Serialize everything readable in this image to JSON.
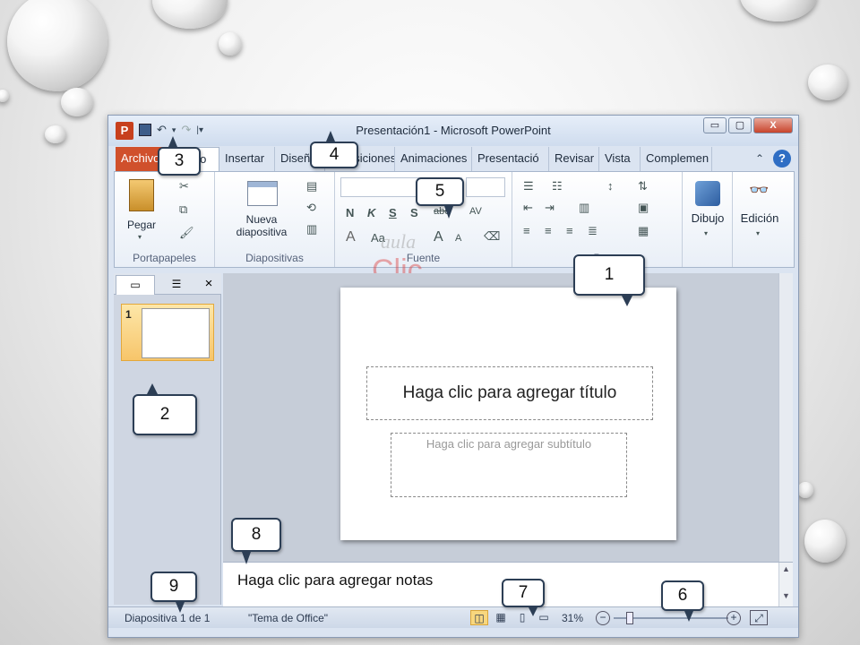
{
  "window": {
    "title": "Presentación1  -  Microsoft PowerPoint",
    "app_icon_letter": "P",
    "controls": {
      "minimize": "▭",
      "maximize": "▢",
      "close": "X"
    }
  },
  "qat": {
    "save_icon": "save-icon",
    "undo_icon": "undo-icon",
    "redo_icon": "redo-icon",
    "customize_icon": "customize-qat-icon"
  },
  "tabs": [
    {
      "label": "Archivo"
    },
    {
      "label": "Inicio"
    },
    {
      "label": "Insertar"
    },
    {
      "label": "Diseño"
    },
    {
      "label": "Transiciones"
    },
    {
      "label": "Animaciones"
    },
    {
      "label": "Presentació"
    },
    {
      "label": "Revisar"
    },
    {
      "label": "Vista"
    },
    {
      "label": "Complemen"
    }
  ],
  "ribbon": {
    "clipboard": {
      "paste_label": "Pegar",
      "group_label": "Portapapeles"
    },
    "slides": {
      "new_slide_line1": "Nueva",
      "new_slide_line2": "diapositiva",
      "group_label": "Diapositivas"
    },
    "font": {
      "group_label": "Fuente",
      "bold": "N",
      "italic": "K",
      "underline": "S",
      "shadow": "S",
      "strike": "abc",
      "spacing": "AV",
      "case": "Aa",
      "grow": "A",
      "shrink": "A"
    },
    "paragraph": {
      "group_label": "P"
    },
    "drawing": {
      "label": "Dibujo"
    },
    "editing": {
      "label": "Edición"
    }
  },
  "slides_panel": {
    "tab_close": "×",
    "slide_number": "1"
  },
  "slide": {
    "title_placeholder": "Haga clic para agregar título",
    "subtitle_placeholder": "Haga clic para agregar subtítulo"
  },
  "notes": {
    "placeholder": "Haga clic para agregar notas"
  },
  "status": {
    "slide_info": "Diapositiva 1 de 1",
    "theme": "\"Tema de Office\"",
    "zoom": "31%"
  },
  "watermark": {
    "line1": "aula",
    "line2": "Clic"
  },
  "callouts": [
    "1",
    "2",
    "3",
    "4",
    "5",
    "6",
    "7",
    "8",
    "9"
  ]
}
